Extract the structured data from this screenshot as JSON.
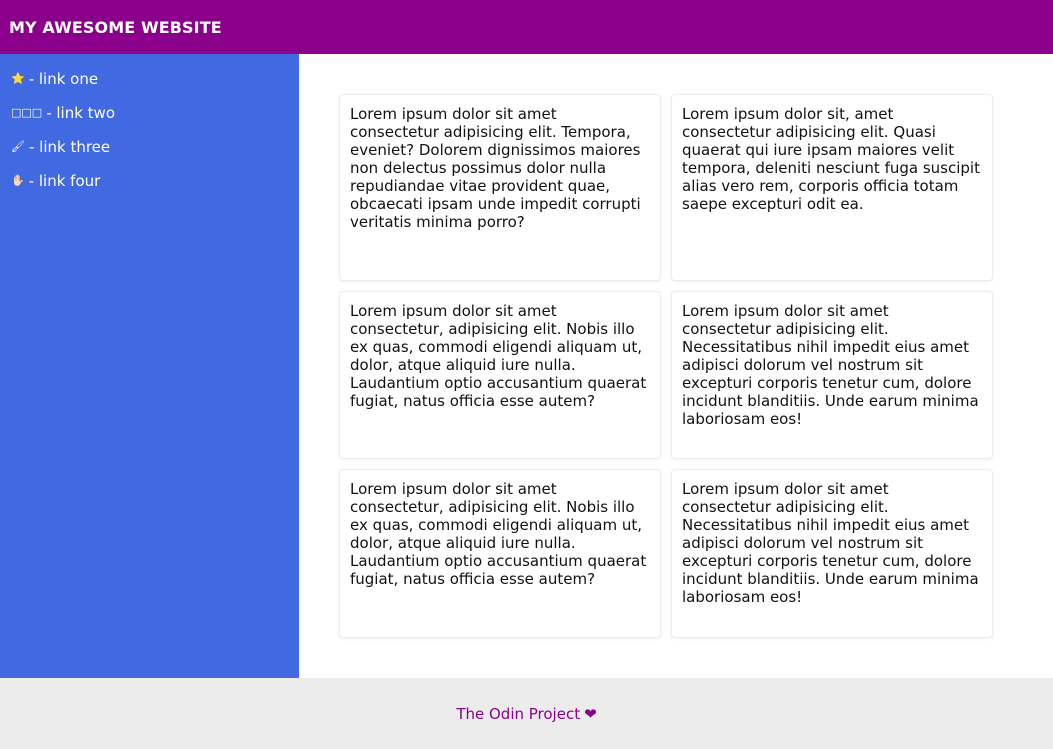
{
  "header": {
    "title": "MY AWESOME WEBSITE"
  },
  "sidebar": {
    "items": [
      {
        "icon_name": "star-icon",
        "icon_glyph": "⭐",
        "label": "- link one"
      },
      {
        "icon_name": "placeholder-glyph-icon",
        "icon_glyph": "□□□",
        "label": "- link two"
      },
      {
        "icon_name": "brush-icon",
        "icon_glyph": "🖌",
        "label": "- link three"
      },
      {
        "icon_name": "hand-icon",
        "icon_glyph": "✋🏻",
        "label": "- link four"
      }
    ]
  },
  "cards": [
    {
      "text": "Lorem ipsum dolor sit amet consectetur adipisicing elit. Tempora, eveniet? Dolorem dignissimos maiores non delectus possimus dolor nulla repudiandae vitae provident quae, obcaecati ipsam unde impedit corrupti veritatis minima porro?"
    },
    {
      "text": "Lorem ipsum dolor sit, amet consectetur adipisicing elit. Quasi quaerat qui iure ipsam maiores velit tempora, deleniti nesciunt fuga suscipit alias vero rem, corporis officia totam saepe excepturi odit ea."
    },
    {
      "text": "Lorem ipsum dolor sit amet consectetur, adipisicing elit. Nobis illo ex quas, commodi eligendi aliquam ut, dolor, atque aliquid iure nulla. Laudantium optio accusantium quaerat fugiat, natus officia esse autem?"
    },
    {
      "text": "Lorem ipsum dolor sit amet consectetur adipisicing elit. Necessitatibus nihil impedit eius amet adipisci dolorum vel nostrum sit excepturi corporis tenetur cum, dolore incidunt blanditiis. Unde earum minima laboriosam eos!"
    },
    {
      "text": "Lorem ipsum dolor sit amet consectetur, adipisicing elit. Nobis illo ex quas, commodi eligendi aliquam ut, dolor, atque aliquid iure nulla. Laudantium optio accusantium quaerat fugiat, natus officia esse autem?"
    },
    {
      "text": "Lorem ipsum dolor sit amet consectetur adipisicing elit. Necessitatibus nihil impedit eius amet adipisci dolorum vel nostrum sit excepturi corporis tenetur cum, dolore incidunt blanditiis. Unde earum minima laboriosam eos!"
    }
  ],
  "footer": {
    "link_text": "The Odin Project",
    "heart_glyph": "❤"
  },
  "colors": {
    "header_bg": "#8b008b",
    "sidebar_bg": "#4169e1",
    "footer_bg": "#ececec",
    "footer_link": "#8b008b"
  }
}
